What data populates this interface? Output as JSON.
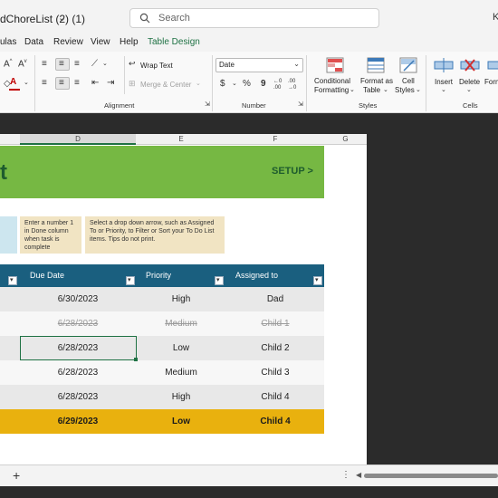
{
  "window": {
    "doc_title": "dChoreList (2) (1)",
    "doc_title_chevron": "⌄",
    "search_placeholder": "Search",
    "user_initial": "K"
  },
  "menu": {
    "tabs": [
      "ulas",
      "Data",
      "Review",
      "View",
      "Help",
      "Table Design"
    ],
    "active": "Table Design"
  },
  "ribbon": {
    "alignment": {
      "wrap_text": "Wrap Text",
      "merge_center": "Merge & Center",
      "label": "Alignment"
    },
    "number": {
      "format_value": "Date",
      "currency": "$",
      "percent": "%",
      "comma": "9",
      "inc_decimal": "←0 .00",
      "dec_decimal": ".00 →0",
      "label": "Number"
    },
    "styles": {
      "conditional_formatting_1": "Conditional",
      "conditional_formatting_2": "Formatting",
      "format_as_table_1": "Format as",
      "format_as_table_2": "Table",
      "cell_styles_1": "Cell",
      "cell_styles_2": "Styles",
      "label": "Styles"
    },
    "cells": {
      "insert": "Insert",
      "delete": "Delete",
      "format": "Form",
      "label": "Cells"
    },
    "font_partial": {
      "a_grow": "A",
      "a_color": "A"
    }
  },
  "columns": [
    "D",
    "E",
    "F",
    "G"
  ],
  "banner": {
    "title_fragment": "t",
    "setup_link": "SETUP >"
  },
  "tips": {
    "tip1": "Enter a number 1 in Done column when task is complete",
    "tip2": "Select a drop down arrow, such as Assigned To or Priority, to Filter or Sort your To Do List items. Tips do not print."
  },
  "table": {
    "headers": [
      "Due Date",
      "Priority",
      "Assigned to"
    ],
    "rows": [
      {
        "due": "6/30/2023",
        "priority": "High",
        "assigned": "Dad",
        "state": "normal"
      },
      {
        "due": "6/28/2023",
        "priority": "Medium",
        "assigned": "Child 1",
        "state": "done"
      },
      {
        "due": "6/28/2023",
        "priority": "Low",
        "assigned": "Child 2",
        "state": "normal"
      },
      {
        "due": "6/28/2023",
        "priority": "Medium",
        "assigned": "Child 3",
        "state": "normal"
      },
      {
        "due": "6/28/2023",
        "priority": "High",
        "assigned": "Child 4",
        "state": "normal"
      },
      {
        "due": "6/29/2023",
        "priority": "Low",
        "assigned": "Child 4",
        "state": "highlight"
      }
    ]
  },
  "sheetbar": {
    "add_sheet": "+",
    "more": "⋮",
    "scroll_left": "◀"
  },
  "colors": {
    "banner_green": "#76b843",
    "banner_text": "#1e5c2e",
    "header_blue": "#1a5f7f",
    "highlight_yellow": "#e9b10e",
    "accent_green": "#1f7244"
  }
}
